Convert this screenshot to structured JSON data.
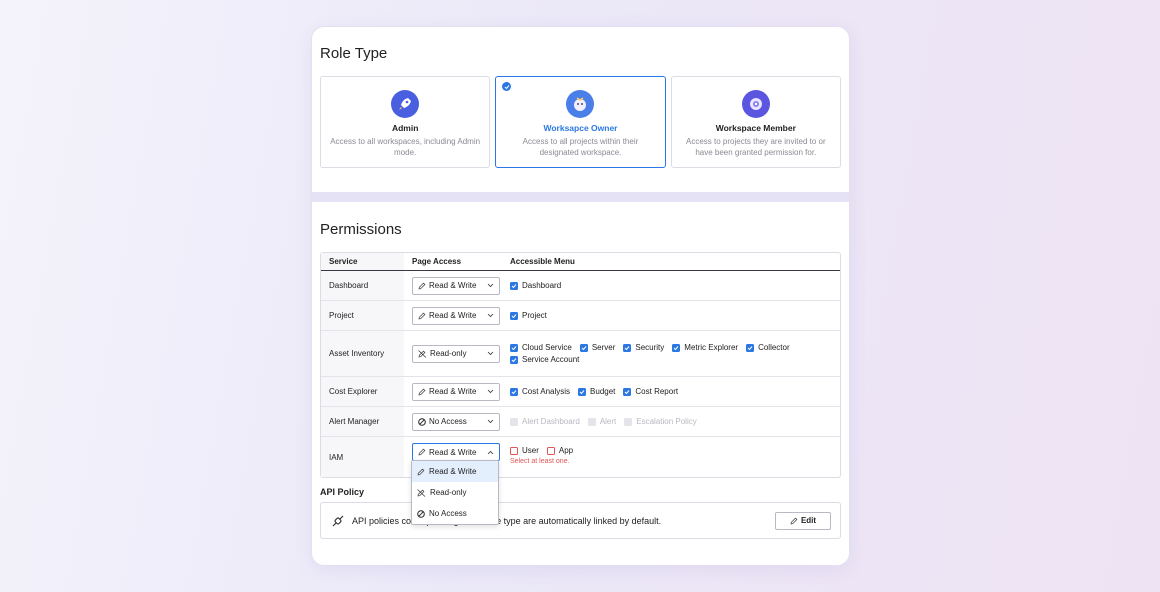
{
  "role_type": {
    "title": "Role Type",
    "roles": [
      {
        "name": "Admin",
        "desc": "Access to all workspaces, including Admin mode.",
        "icon": "rocket-icon"
      },
      {
        "name": "Worksapce Owner",
        "desc": "Access to all projects within their designated workspace.",
        "icon": "owner-icon",
        "selected": true
      },
      {
        "name": "Workspace Member",
        "desc": "Access to projects they are invited to or have been granted permission for.",
        "icon": "member-icon"
      }
    ]
  },
  "permissions": {
    "title": "Permissions",
    "headers": {
      "service": "Service",
      "page_access": "Page Access",
      "menu": "Accessible Menu"
    },
    "rows": [
      {
        "service": "Dashboard",
        "access": "Read & Write",
        "menus": [
          "Dashboard"
        ]
      },
      {
        "service": "Project",
        "access": "Read & Write",
        "menus": [
          "Project"
        ]
      },
      {
        "service": "Asset Inventory",
        "access": "Read-only",
        "menus": [
          "Cloud Service",
          "Server",
          "Security",
          "Metric Explorer",
          "Collector",
          "Service Account"
        ]
      },
      {
        "service": "Cost Explorer",
        "access": "Read & Write",
        "menus": [
          "Cost Analysis",
          "Budget",
          "Cost Report"
        ]
      },
      {
        "service": "Alert Manager",
        "access": "No Access",
        "menus": [
          "Alert Dashboard",
          "Alert",
          "Escalation Policy"
        ]
      },
      {
        "service": "IAM",
        "access": "Read & Write",
        "menus": [
          "User",
          "App"
        ],
        "error": "Select at least one."
      }
    ]
  },
  "dropdown": {
    "options": [
      "Read & Write",
      "Read-only",
      "No Access"
    ]
  },
  "api_policy": {
    "title": "API Policy",
    "text": "API policies corresponding to the role type are automatically linked by default.",
    "edit_label": "Edit"
  },
  "colors": {
    "accent": "#2b78e4",
    "error": "#e25555"
  }
}
